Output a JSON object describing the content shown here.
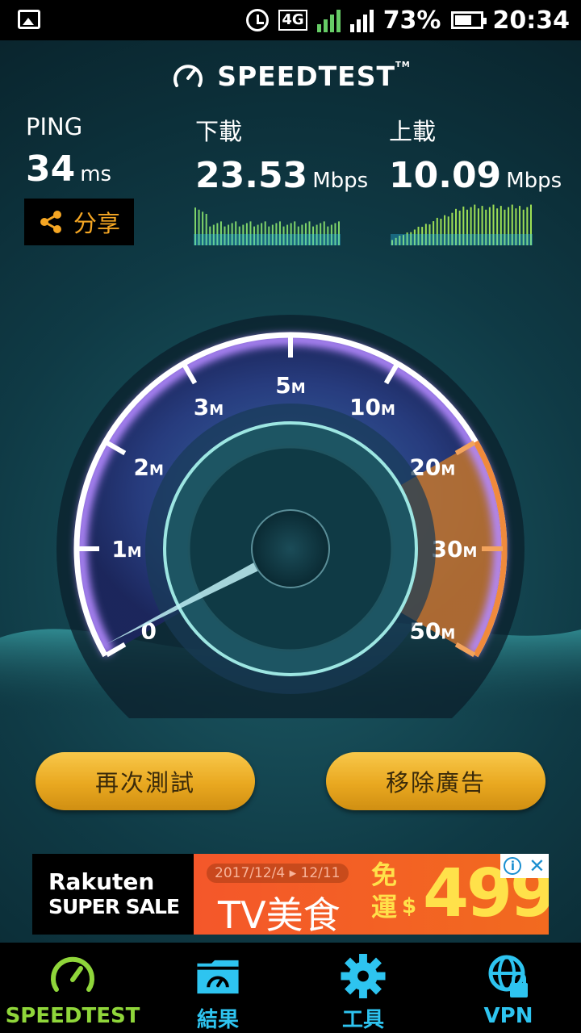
{
  "status_bar": {
    "battery": "73%",
    "time": "20:34",
    "network": "4G"
  },
  "app": {
    "title": "SPEEDTEST",
    "trademark": "TM"
  },
  "ping": {
    "label": "PING",
    "value": "34",
    "unit": "ms"
  },
  "download": {
    "label": "下載",
    "value": "23.53",
    "unit": "Mbps"
  },
  "upload": {
    "label": "上載",
    "value": "10.09",
    "unit": "Mbps"
  },
  "share": {
    "label": "分享"
  },
  "gauge": {
    "scale_labels": [
      {
        "num": "0",
        "unit": ""
      },
      {
        "num": "1",
        "unit": "M"
      },
      {
        "num": "2",
        "unit": "M"
      },
      {
        "num": "3",
        "unit": "M"
      },
      {
        "num": "5",
        "unit": "M"
      },
      {
        "num": "10",
        "unit": "M"
      },
      {
        "num": "20",
        "unit": "M"
      },
      {
        "num": "30",
        "unit": "M"
      },
      {
        "num": "50",
        "unit": "M"
      }
    ],
    "needle_value": "0"
  },
  "buttons": {
    "retest": "再次測試",
    "remove_ads": "移除廣告"
  },
  "ad": {
    "brand": "Rakuten",
    "sale": "SUPER SALE",
    "date": "2017/12/4 ▸ 12/11",
    "title": "TV美食",
    "free": "免運",
    "currency": "$",
    "price": "499"
  },
  "nav": [
    {
      "label": "SPEEDTEST",
      "icon": "speedometer-icon"
    },
    {
      "label": "結果",
      "icon": "results-folder-icon"
    },
    {
      "label": "工具",
      "icon": "gear-icon"
    },
    {
      "label": "VPN",
      "icon": "globe-lock-icon"
    }
  ],
  "colors": {
    "accent_green": "#8fd63a",
    "accent_cyan": "#2ec4f0",
    "button_gold": "#e9a820",
    "share_orange": "#f5a623"
  }
}
